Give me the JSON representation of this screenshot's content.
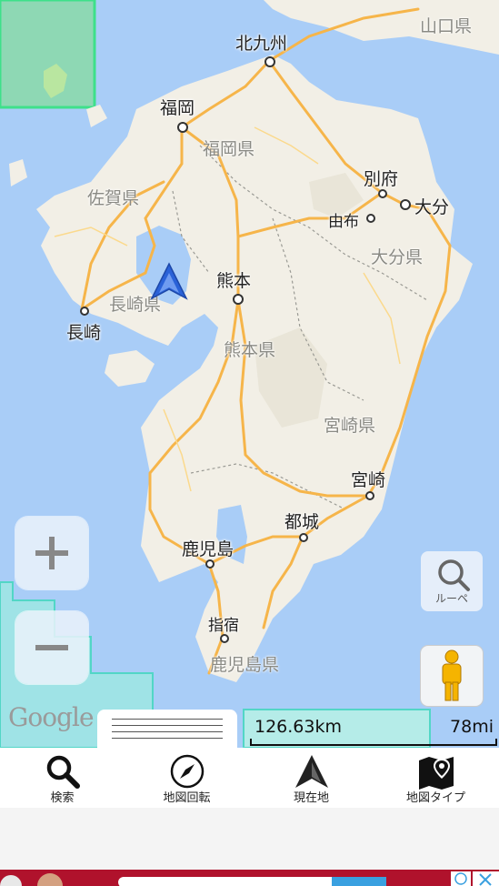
{
  "map": {
    "cities": [
      {
        "name": "北九州"
      },
      {
        "name": "福岡"
      },
      {
        "name": "別府"
      },
      {
        "name": "大分"
      },
      {
        "name": "由布"
      },
      {
        "name": "熊本"
      },
      {
        "name": "長崎"
      },
      {
        "name": "宮崎"
      },
      {
        "name": "都城"
      },
      {
        "name": "鹿児島"
      },
      {
        "name": "指宿"
      }
    ],
    "prefectures": [
      {
        "name": "山口県"
      },
      {
        "name": "福岡県"
      },
      {
        "name": "佐賀県"
      },
      {
        "name": "大分県"
      },
      {
        "name": "長崎県"
      },
      {
        "name": "熊本県"
      },
      {
        "name": "宮崎県"
      },
      {
        "name": "鹿児島県"
      }
    ],
    "google_logo": "Google",
    "scale": {
      "km": "126.63km",
      "mi": "78mi"
    }
  },
  "controls": {
    "zoom_in": "+",
    "zoom_out": "−",
    "loupe_label": "ルーペ"
  },
  "toolbar": {
    "search": "検索",
    "rotate": "地図回転",
    "location": "現在地",
    "maptype": "地図タイプ"
  },
  "colors": {
    "sea": "#a9cdf7",
    "land": "#f2efe6",
    "road": "#f6b54a",
    "accent": "#2a62d8"
  }
}
